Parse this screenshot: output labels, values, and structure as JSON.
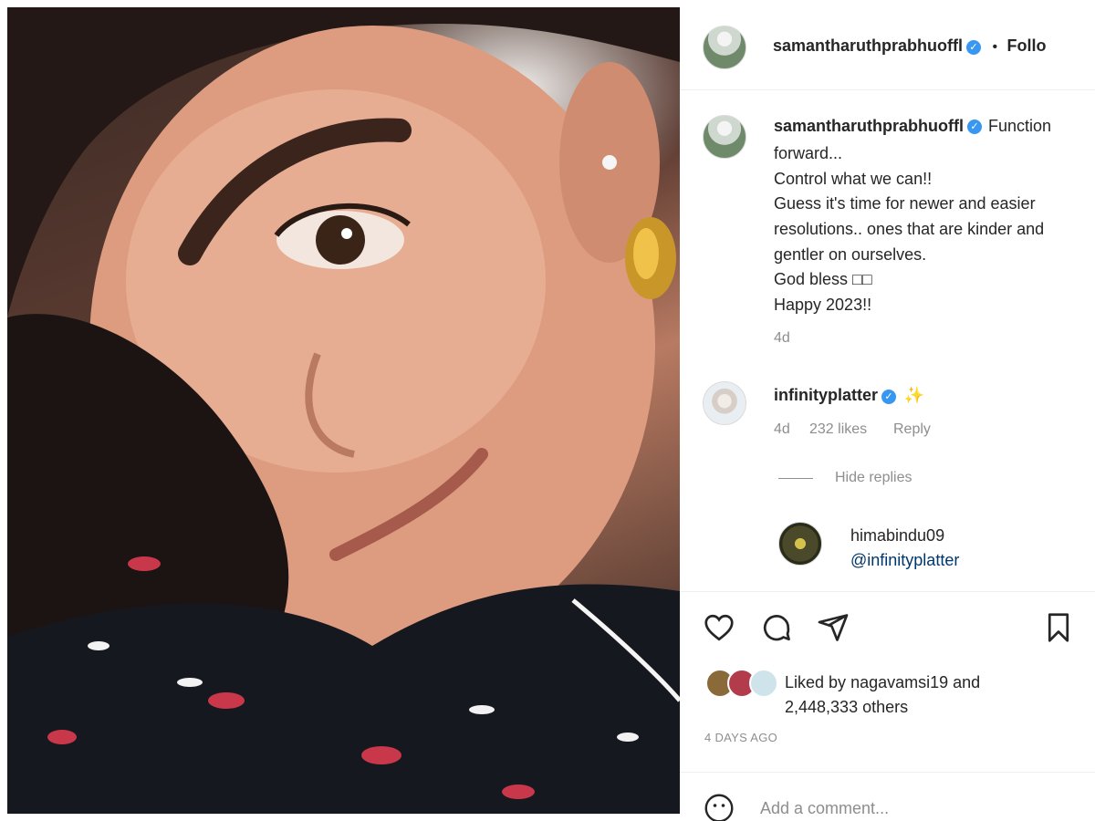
{
  "post": {
    "author": "samantharuthprabhuoffl",
    "follow_text": "Follo",
    "separator": "•",
    "verified_glyph": "✓",
    "caption": {
      "first_line": "Function",
      "lines": [
        "forward...",
        "Control what we can!!",
        "Guess it's time for newer and easier",
        "resolutions.. ones that are kinder and",
        "gentler on ourselves.",
        "God bless □□",
        "Happy 2023!!"
      ],
      "time": "4d"
    },
    "comments": [
      {
        "user": "infinityplatter",
        "emoji": "✨",
        "time": "4d",
        "likes": "232 likes",
        "reply_label": "Reply"
      }
    ],
    "hide_replies": "Hide replies",
    "reply": {
      "user": "himabindu09",
      "text": "@infinityplatter"
    },
    "actions": {
      "like_icon": "heart-icon",
      "comment_icon": "comment-icon",
      "share_icon": "send-icon",
      "save_icon": "bookmark-icon"
    },
    "liked_by": {
      "prefix": "Liked by",
      "user": "nagavamsi19",
      "and": "and",
      "others": "2,448,333 others"
    },
    "posted_ago": "4 DAYS AGO",
    "add_comment_placeholder": "Add a comment..."
  },
  "colors": {
    "verified": "#3897f0",
    "muted": "#8e8e8e",
    "text": "#262626",
    "divider": "#efefef"
  }
}
